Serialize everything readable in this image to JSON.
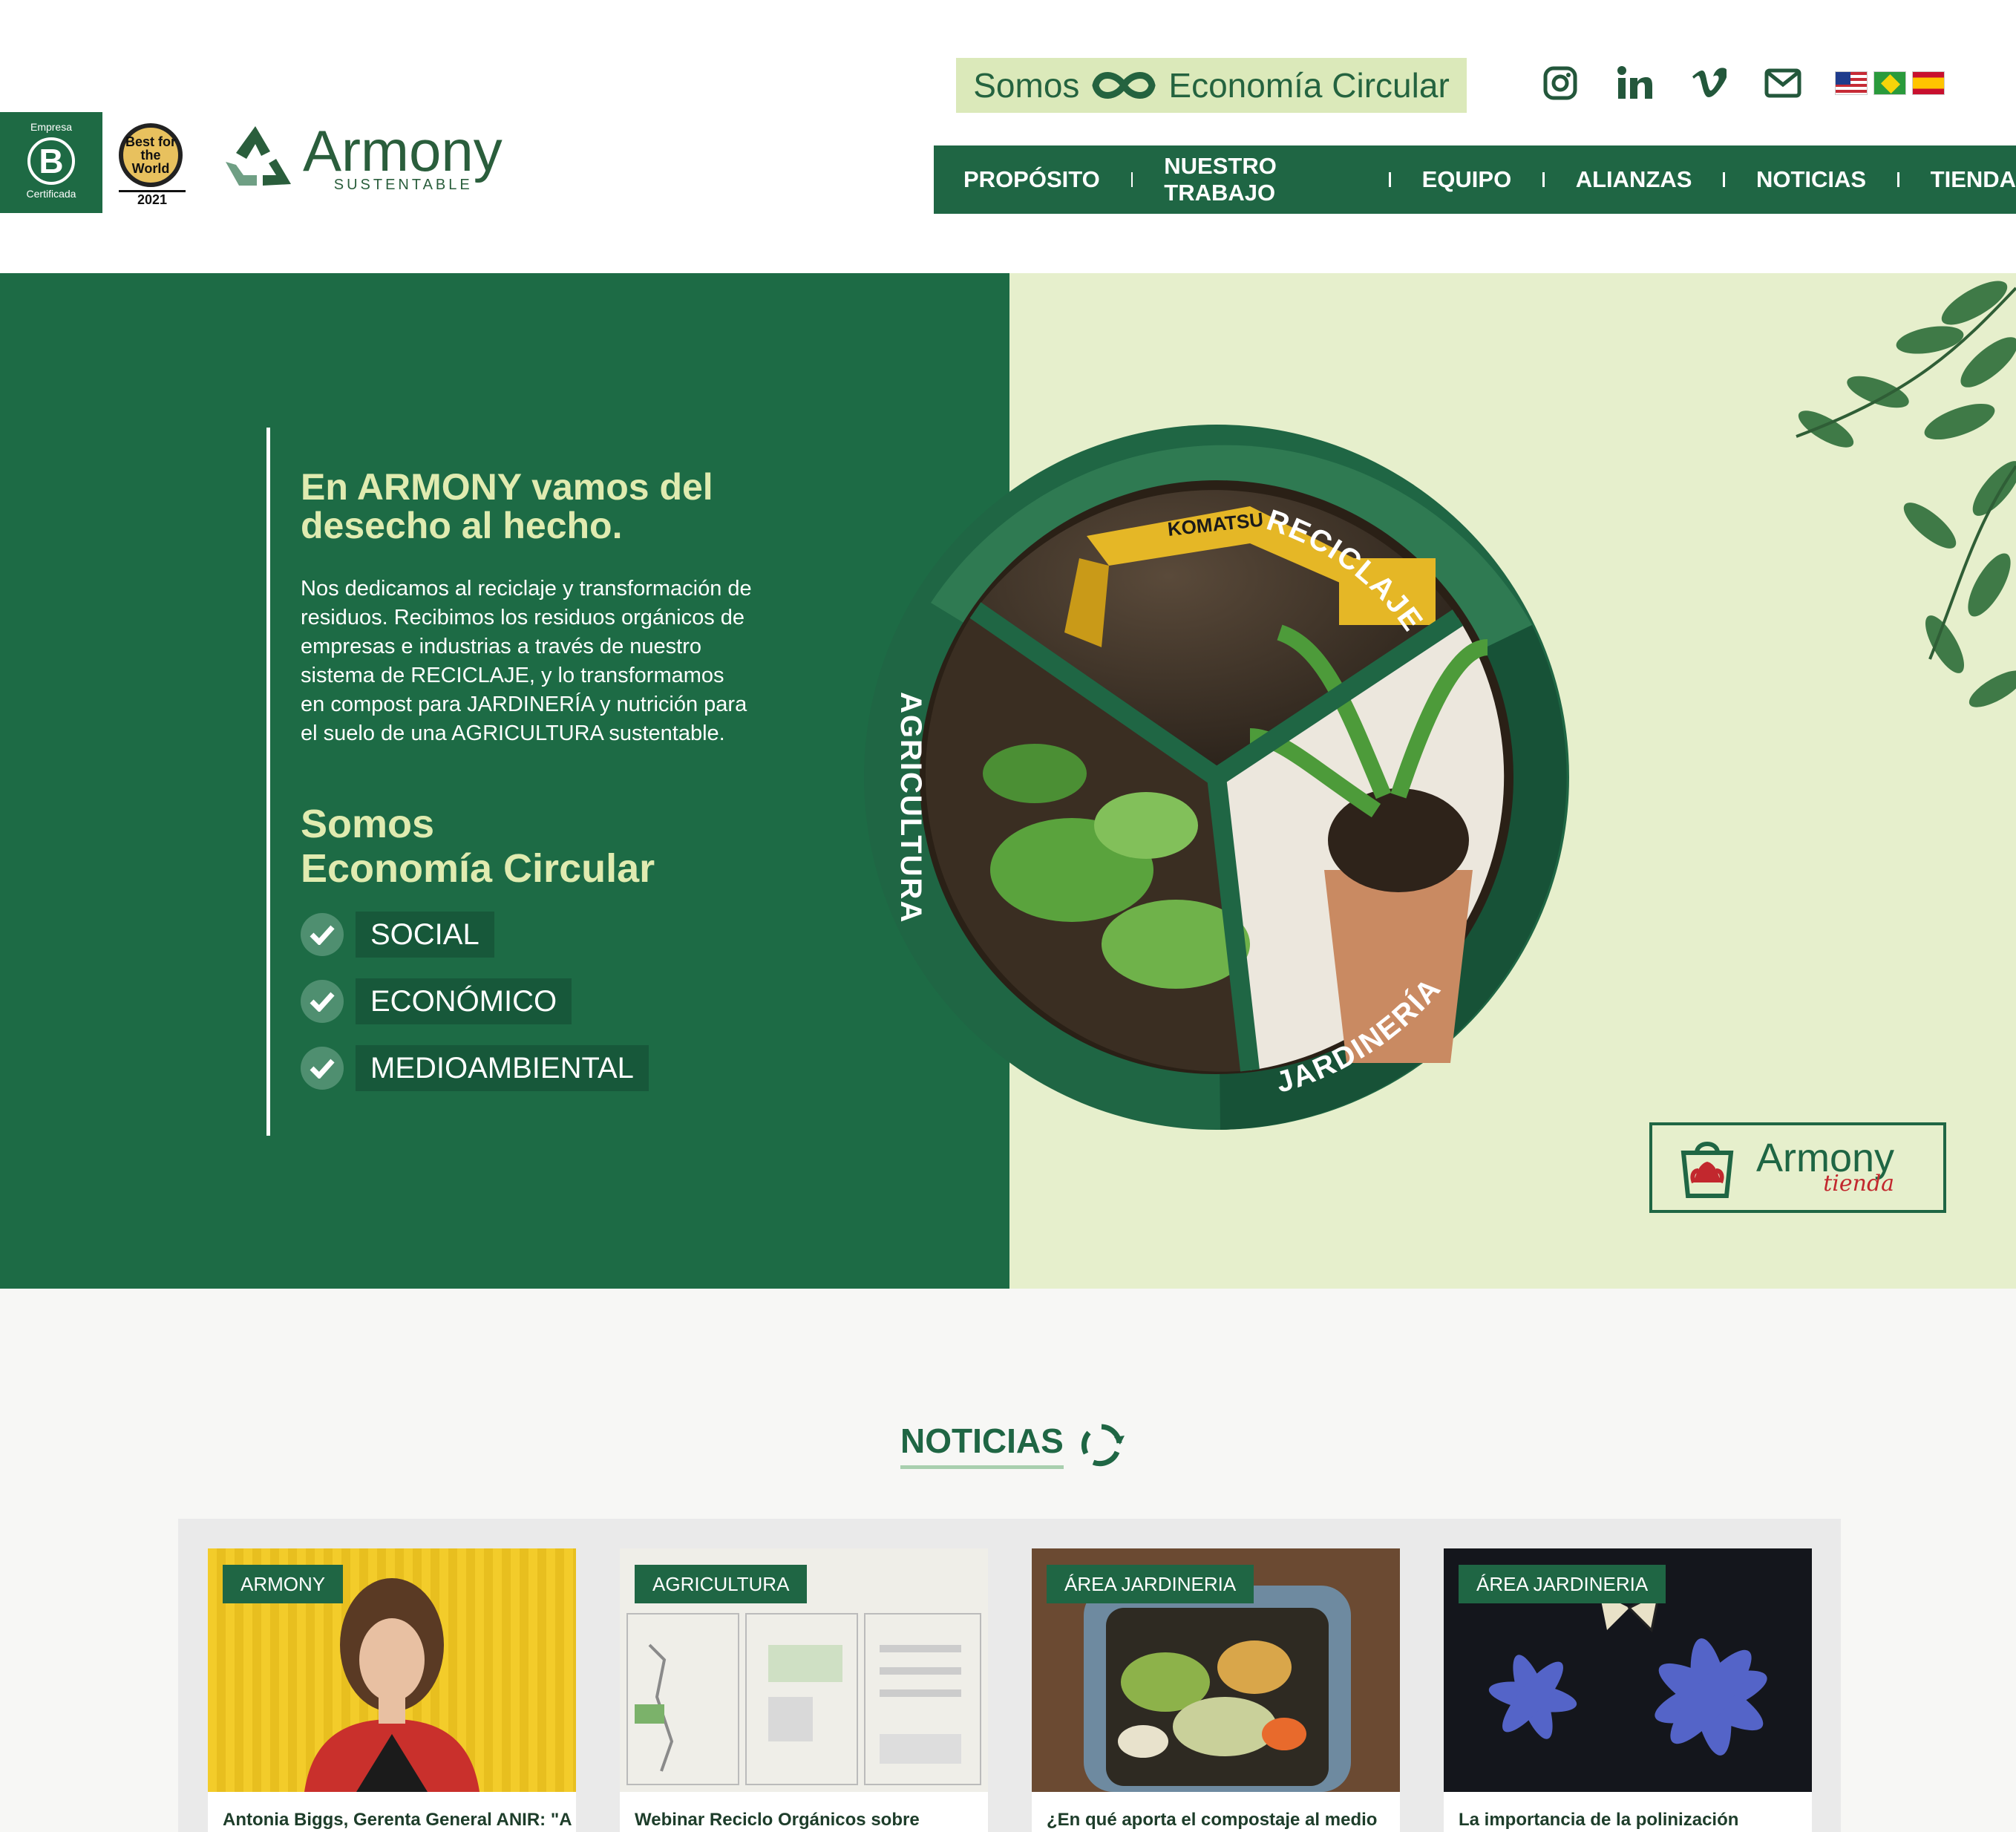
{
  "header": {
    "banner_left": "Somos",
    "banner_right": "Economía Circular",
    "bcorp_top": "Empresa",
    "bcorp_bottom": "Certificada",
    "bftw_text": "Best for the World",
    "bftw_year": "2021",
    "logo_name": "Armony",
    "logo_sub": "SUSTENTABLE",
    "social_icons": [
      "instagram-icon",
      "linkedin-icon",
      "vimeo-icon",
      "mail-icon"
    ],
    "flags": [
      "us-flag",
      "brazil-flag",
      "spain-flag"
    ]
  },
  "nav": {
    "items": [
      "PROPÓSITO",
      "NUESTRO TRABAJO",
      "EQUIPO",
      "ALIANZAS",
      "NOTICIAS",
      "TIENDA"
    ]
  },
  "hero": {
    "title": "En ARMONY vamos del desecho al hecho.",
    "text": "Nos dedicamos al reciclaje y transformación de residuos. Recibimos los residuos orgánicos de empresas e industrias a través de nuestro sistema de RECICLAJE, y lo transformamos en compost para JARDINERÍA y nutrición para el suelo de una AGRICULTURA sustentable.",
    "eco_line1": "Somos",
    "eco_line2": "Economía Circular",
    "checks": [
      "SOCIAL",
      "ECONÓMICO",
      "MEDIOAMBIENTAL"
    ],
    "wheel_labels": [
      "RECICLAJE",
      "JARDINERÍA",
      "AGRICULTURA"
    ],
    "excavator_text": "KOMATSU",
    "tienda_name": "Armony",
    "tienda_sub": "tienda"
  },
  "news": {
    "title": "NOTICIAS",
    "cards": [
      {
        "tag": "ARMONY",
        "title": "Antonia Biggs, Gerenta General ANIR: \"A"
      },
      {
        "tag": "AGRICULTURA",
        "title": "Webinar Reciclo Orgánicos sobre"
      },
      {
        "tag": "ÁREA JARDINERIA",
        "title": "¿En qué aporta el compostaje al medio"
      },
      {
        "tag": "ÁREA JARDINERIA",
        "title": "La importancia de la polinización"
      }
    ]
  },
  "colors": {
    "brand_green": "#1f6644",
    "hero_green": "#1d6b45",
    "light_green": "#e6efcc",
    "accent_yellow_green": "#e0ebb0",
    "tienda_red": "#c2282e"
  }
}
